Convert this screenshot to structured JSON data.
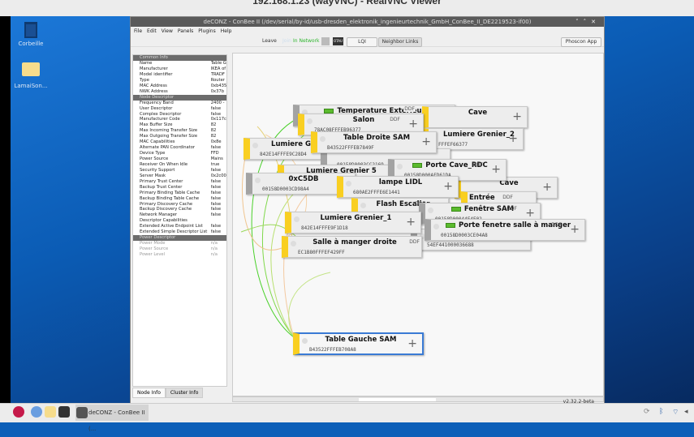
{
  "vnc_title": "192.168.1.23 (wayVNC) - RealVNC Viewer",
  "desktop": {
    "icons": [
      {
        "label": "Corbeille"
      },
      {
        "label": "LamaiSon..."
      }
    ]
  },
  "window": {
    "title": "deCONZ - ConBee II (/dev/serial/by-id/usb-dresden_elektronik_ingenieurtechnik_GmbH_ConBee_II_DE2219523-if00)",
    "menu": [
      "File",
      "Edit",
      "View",
      "Panels",
      "Plugins",
      "Help"
    ],
    "toolbar": {
      "leave": "Leave",
      "join": "Join",
      "in_network": "In Network",
      "otau": "OTAU",
      "lqi": "LQI",
      "neighbor_links": "Neighbor Links",
      "phoscon": "Phoscon App"
    },
    "version": "v2.32.2-beta"
  },
  "node_info": {
    "sections": [
      {
        "title": "Common Info",
        "rows": [
          [
            "Name",
            "Table G"
          ],
          [
            "Manufacturer",
            "IKEA of"
          ],
          [
            "Model identifier",
            "TRADF"
          ],
          [
            "Type",
            "Router"
          ],
          [
            "MAC Address",
            "0xb435"
          ],
          [
            "NWK Address",
            "0x37b"
          ]
        ]
      },
      {
        "title": "Node Descriptor",
        "rows": [
          [
            "Frequency Band",
            "2400 -"
          ],
          [
            "User Descriptor",
            "false"
          ],
          [
            "Complex Descriptor",
            "false"
          ],
          [
            "Manufacturer Code",
            "0x117c"
          ],
          [
            "Max Buffer Size",
            "82"
          ],
          [
            "Max Incoming Transfer Size",
            "82"
          ],
          [
            "Max Outgoing Transfer Size",
            "82"
          ],
          [
            "MAC Capabilities",
            "0x8e"
          ],
          [
            "Alternate PAN Coordinator",
            "false"
          ],
          [
            "Device Type",
            "FFD"
          ],
          [
            "Power Source",
            "Mains"
          ],
          [
            "Receiver On When Idle",
            "true"
          ],
          [
            "Security Support",
            "false"
          ],
          [
            "Server Mask",
            "0x2c00"
          ],
          [
            "Primary Trust Center",
            "false"
          ],
          [
            "Backup Trust Center",
            "false"
          ],
          [
            "Primary Binding Table Cache",
            "false"
          ],
          [
            "Backup Binding Table Cache",
            "false"
          ],
          [
            "Primary Discovery Cache",
            "false"
          ],
          [
            "Backup Discovery Cache",
            "false"
          ],
          [
            "Network Manager",
            "false"
          ],
          [
            "Descriptor Capabilities",
            ""
          ],
          [
            "Extended Active Endpoint List",
            "false"
          ],
          [
            "Extended Simple Descriptor List",
            "false"
          ]
        ]
      },
      {
        "title": "Power Descriptor",
        "rows": [
          [
            "Power Mode",
            "n/a"
          ],
          [
            "Power Source",
            "n/a"
          ],
          [
            "Power Level",
            "n/a"
          ]
        ]
      }
    ],
    "tabs": [
      "Node Info",
      "Cluster Info"
    ]
  },
  "nodes": [
    {
      "name": "Temperature Extérieure",
      "mac": "",
      "ddf": "DDF",
      "battery": true
    },
    {
      "name": "Cave",
      "mac": "",
      "ddf": ""
    },
    {
      "name": "Lumiere Grenier_2",
      "mac": "FFFEF66377",
      "ddf": ""
    },
    {
      "name": "Salon",
      "mac": "78AC08FFFEB96377",
      "ddf": "DDF"
    },
    {
      "name": "Lumiere G",
      "mac": "842E14FFFE9C28D4",
      "ddf": ""
    },
    {
      "name": "",
      "mac": "00158D0003CC2169",
      "ddf": ""
    },
    {
      "name": "Table Droite SAM",
      "mac": "B43522FFFEB7849F",
      "ddf": ""
    },
    {
      "name": "Cave",
      "mac": "",
      "ddf": ""
    },
    {
      "name": "Lumiere Grenier 5",
      "mac": "",
      "ddf": ""
    },
    {
      "name": "Porte Cave_RDC",
      "mac": "00158D000AFD61DA",
      "ddf": "DDF",
      "battery": true
    },
    {
      "name": "0xC5DB",
      "mac": "00158D0003CD98A4",
      "ddf": ""
    },
    {
      "name": "lampe LIDL",
      "mac": "680AE2FFFE6E1441",
      "ddf": ""
    },
    {
      "name": "Entrée",
      "mac": "",
      "ddf": "DDF"
    },
    {
      "name": "Flash Escalier",
      "mac": "",
      "ddf": "DDF"
    },
    {
      "name": "",
      "mac": "54EF441000036688",
      "ddf": ""
    },
    {
      "name": "Fenêtre SAM",
      "mac": "00158D00044F4E02",
      "ddf": "DDF",
      "battery": true
    },
    {
      "name": "Porte fenetre salle à manger",
      "mac": "00158D0003CE04A8",
      "ddf": "DDF",
      "battery": true
    },
    {
      "name": "Lumiere Grenier_1",
      "mac": "842E14FFFE9F1D18",
      "ddf": ""
    },
    {
      "name": "Salle à manger droite",
      "mac": "EC1B80FFFEF429FF",
      "ddf": "DDF"
    },
    {
      "name": "Table Gauche SAM",
      "mac": "B43522FFFEB708A8",
      "ddf": ""
    }
  ],
  "taskbar": {
    "task": "deCONZ - ConBee II (..."
  }
}
